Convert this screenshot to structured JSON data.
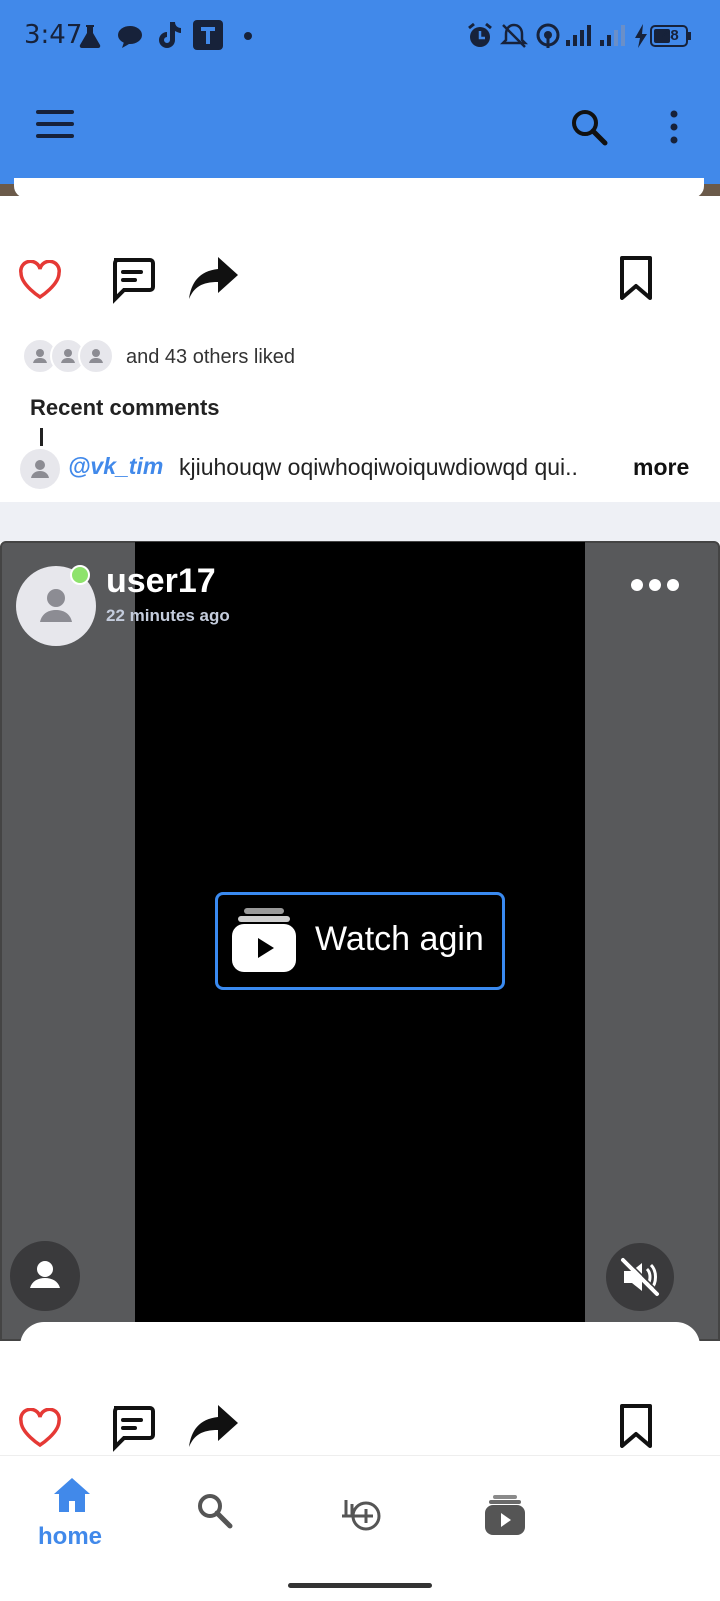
{
  "status_bar": {
    "time": "3:47",
    "battery": "48"
  },
  "app_bar": {
    "menu_icon": "hamburger-menu-icon",
    "search_icon": "search-icon",
    "more_icon": "more-vertical-icon"
  },
  "post1": {
    "likes_text": "and 43 others liked",
    "recent_comments_title": "Recent comments",
    "comment": {
      "user": "@vk_tim",
      "text": "kjiuhouqw oqiwhoqiwoiquwdiowqd qui..",
      "more": "more"
    }
  },
  "post2": {
    "username": "user17",
    "time": "22 minutes ago",
    "watch_again_label": "Watch agin"
  },
  "bottom_nav": {
    "home_label": "home"
  },
  "colors": {
    "accent": "#4189ea",
    "like_red": "#e53935",
    "online_green": "#8ee36c"
  }
}
